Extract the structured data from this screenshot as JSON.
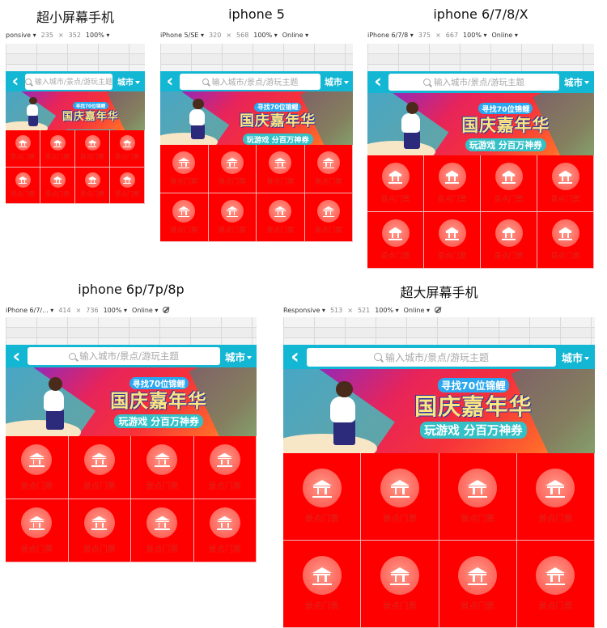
{
  "app": {
    "search_placeholder": "输入城市/景点/游玩主题",
    "city_label": "城市",
    "back_glyph": "‹",
    "banner": {
      "tag": "寻找70位锦鲤",
      "title": "国庆嘉年华",
      "subtitle": "玩游戏 分百万神券"
    },
    "cell_label": "景点门票"
  },
  "colors": {
    "nav": "#13b6d3",
    "grid_bg": "#ff0000",
    "cell_label": "#d9261c"
  },
  "panels": [
    {
      "title": "超小屏幕手机",
      "device": "ponsive",
      "width": "235",
      "height": "352",
      "zoom": "100%",
      "network": "",
      "cols": 4,
      "rows": 2
    },
    {
      "title": "iphone 5",
      "device": "iPhone 5/SE",
      "width": "320",
      "height": "568",
      "zoom": "100%",
      "network": "Online",
      "cols": 4,
      "rows": 2
    },
    {
      "title": "iphone 6/7/8/X",
      "device": "iPhone 6/7/8",
      "width": "375",
      "height": "667",
      "zoom": "100%",
      "network": "Online",
      "cols": 4,
      "rows": 2
    },
    {
      "title": "iphone 6p/7p/8p",
      "device": "iPhone 6/7/...",
      "width": "414",
      "height": "736",
      "zoom": "100%",
      "network": "Online",
      "cols": 4,
      "rows": 2
    },
    {
      "title": "超大屏幕手机",
      "device": "Responsive",
      "width": "513",
      "height": "521",
      "zoom": "100%",
      "network": "Online",
      "cols": 4,
      "rows": 2
    }
  ]
}
